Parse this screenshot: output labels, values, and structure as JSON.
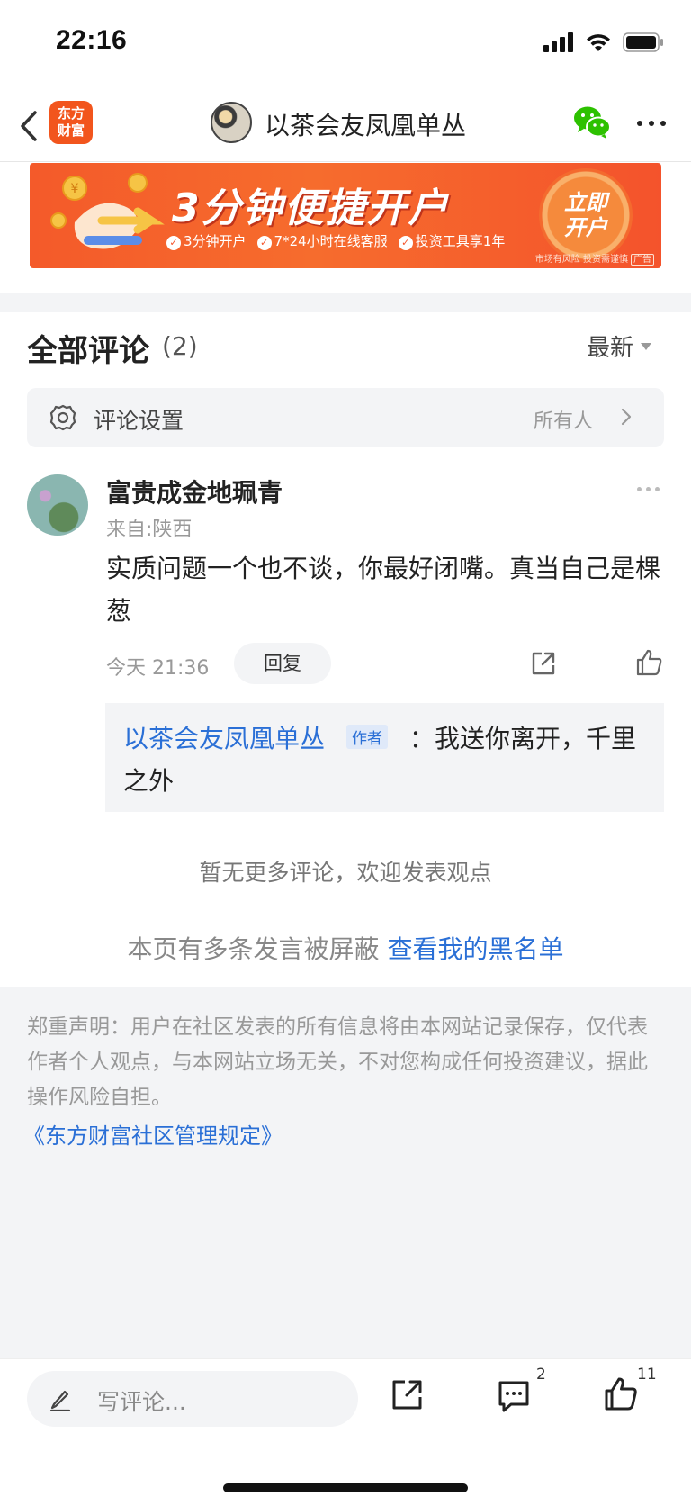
{
  "status_bar": {
    "time": "22:16"
  },
  "nav": {
    "logo_line1": "东方",
    "logo_line2": "财富",
    "title": "以茶会友凤凰单丛"
  },
  "ad": {
    "headline": "3分钟便捷开户",
    "features": [
      "3分钟开户",
      "7*24小时在线客服",
      "投资工具享1年"
    ],
    "cta_line1": "立即",
    "cta_line2": "开户",
    "risk_note": "市场有风险 投资需谨慎",
    "ad_tag": "广告"
  },
  "comments": {
    "title": "全部评论",
    "count": "(2)",
    "sort_label": "最新",
    "settings_label": "评论设置",
    "settings_value": "所有人",
    "items": [
      {
        "user": "富贵成金地珮青",
        "location": "来自:陕西",
        "text": "实质问题一个也不谈，你最好闭嘴。真当自己是棵葱",
        "time": "今天 21:36",
        "reply_label": "回复",
        "reply": {
          "author": "以茶会友凤凰单丛",
          "tag": "作者",
          "text_line1": "：我送你离开，千里",
          "text_line2": "之外"
        }
      }
    ],
    "no_more": "暂无更多评论，欢迎发表观点",
    "blocked_text": "本页有多条发言被屏蔽",
    "blocked_link": "查看我的黑名单"
  },
  "disclaimer": {
    "text": "郑重声明：用户在社区发表的所有信息将由本网站记录保存，仅代表作者个人观点，与本网站立场无关，不对您构成任何投资建议，据此操作风险自担。",
    "rules_link": "《东方财富社区管理规定》"
  },
  "bottom_bar": {
    "placeholder": "写评论...",
    "comment_count": "2",
    "like_count": "11"
  },
  "icons": [
    "back-icon",
    "wechat-icon",
    "more-icon",
    "gear-icon",
    "chevron-right-icon",
    "share-icon",
    "like-icon",
    "pen-icon",
    "comment-icon",
    "signal-icon",
    "wifi-icon",
    "battery-icon"
  ],
  "colors": {
    "accent_blue": "#2a6fd6",
    "brand_orange": "#f2551d",
    "wechat_green": "#2dc100"
  }
}
